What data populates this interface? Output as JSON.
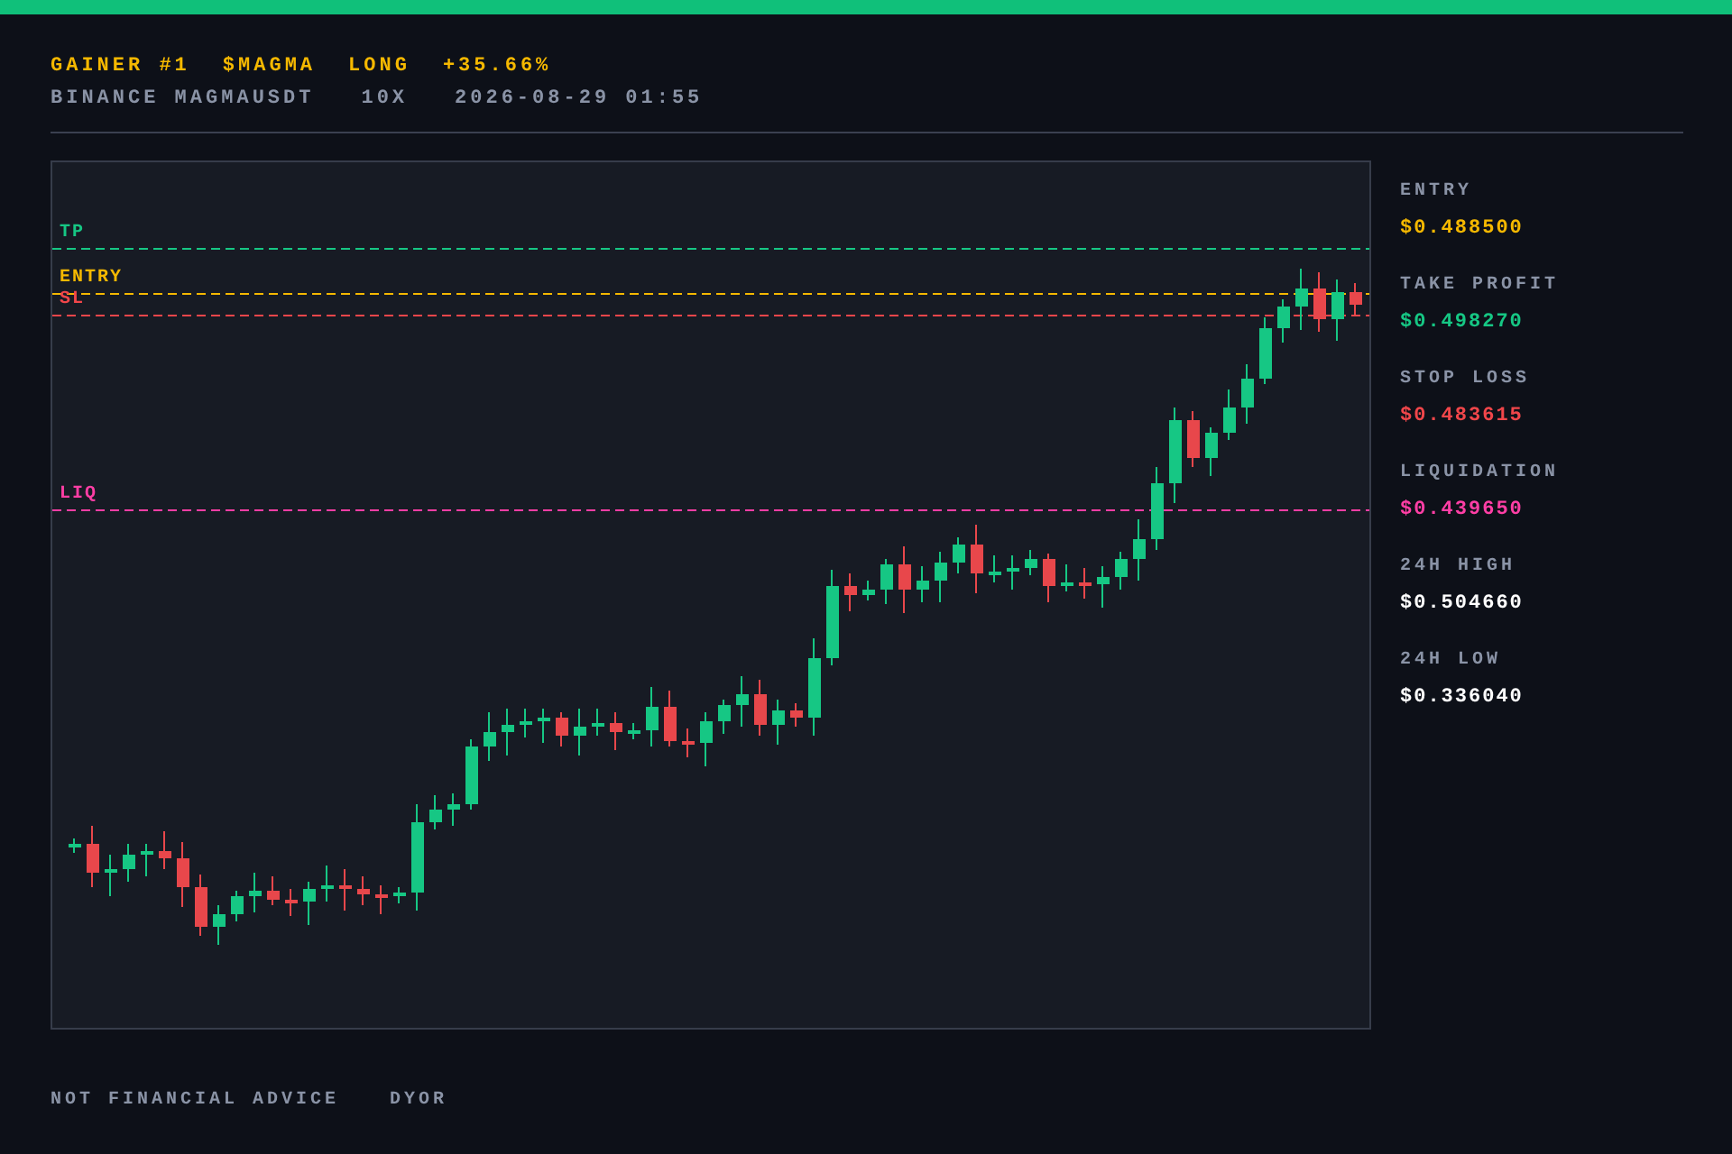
{
  "header": {
    "title": [
      "GAINER #1",
      "$MAGMA",
      "LONG",
      "+35.66%"
    ],
    "subtitle": [
      "BINANCE MAGMAUSDT",
      "10X",
      "2026-08-29 01:55"
    ]
  },
  "chart": {
    "levels": [
      {
        "label": "TP",
        "color": "#16c784"
      },
      {
        "label": "ENTRY",
        "color": "#f5b800"
      },
      {
        "label": "SL",
        "color": "#f0464a"
      },
      {
        "label": "LIQ",
        "color": "#ff3ea5"
      }
    ]
  },
  "stats": [
    {
      "label": "ENTRY",
      "value": "$0.488500",
      "color": "#f5b800"
    },
    {
      "label": "TAKE PROFIT",
      "value": "$0.498270",
      "color": "#16c784"
    },
    {
      "label": "STOP LOSS",
      "value": "$0.483615",
      "color": "#f0464a"
    },
    {
      "label": "LIQUIDATION",
      "value": "$0.439650",
      "color": "#ff3ea5"
    },
    {
      "label": "24H HIGH",
      "value": "$0.504660",
      "color": "#ffffff"
    },
    {
      "label": "24H LOW",
      "value": "$0.336040",
      "color": "#ffffff"
    }
  ],
  "footer": [
    "NOT FINANCIAL ADVICE",
    "DYOR"
  ]
}
